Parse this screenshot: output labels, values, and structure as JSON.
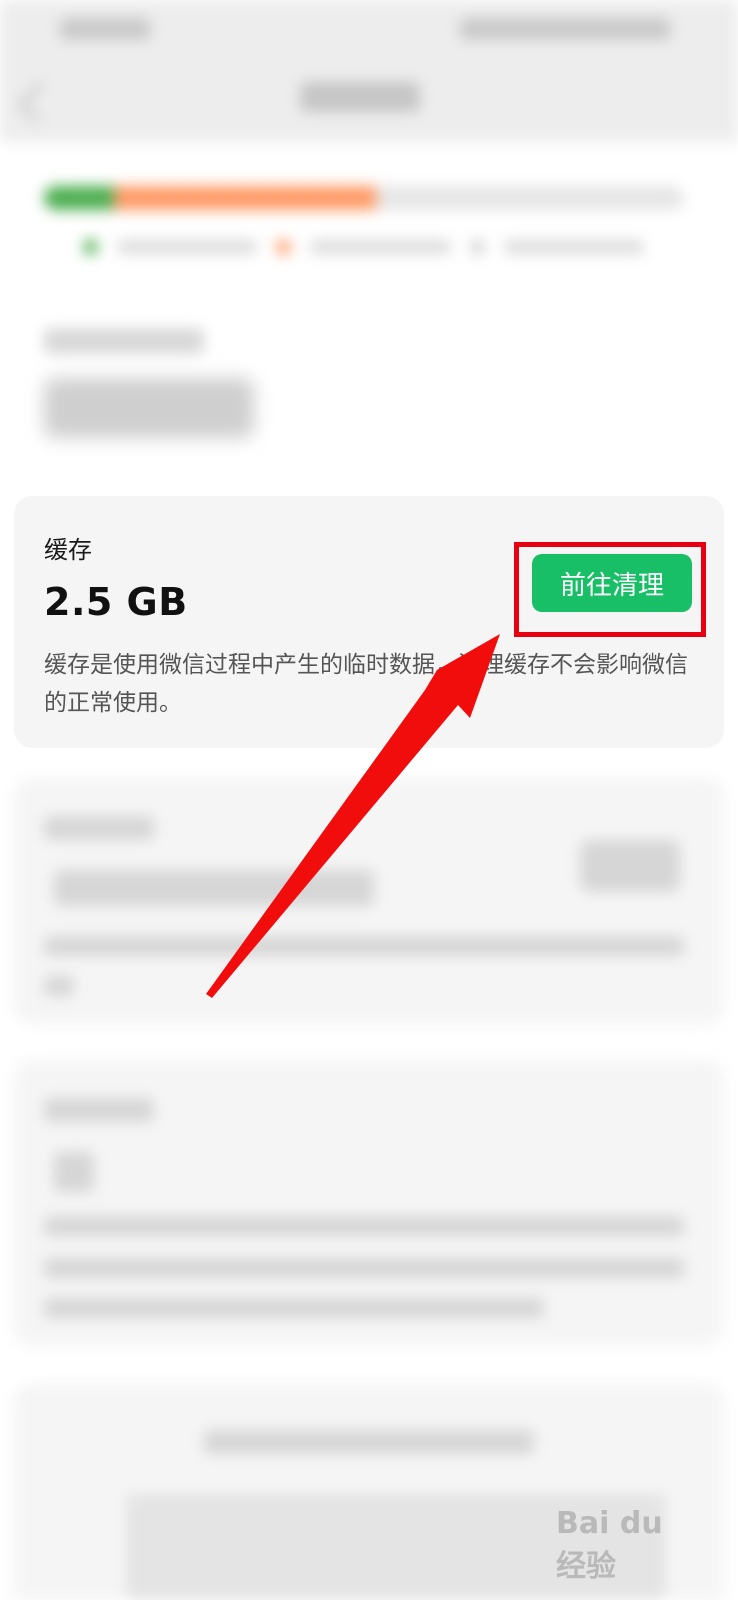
{
  "cache": {
    "title": "缓存",
    "size": "2.5 GB",
    "button_label": "前往清理",
    "description": "缓存是使用微信过程中产生的临时数据，清理缓存不会影响微信的正常使用。"
  },
  "colors": {
    "accent_green": "#19bf66",
    "annotation_red": "#e60012",
    "bar_green": "#4caf50",
    "bar_orange": "#ff9a66"
  },
  "icons": {
    "back": "chevron-left-icon",
    "annotation": "red-arrow-icon"
  },
  "watermark": {
    "text": "Bai du 经验"
  }
}
